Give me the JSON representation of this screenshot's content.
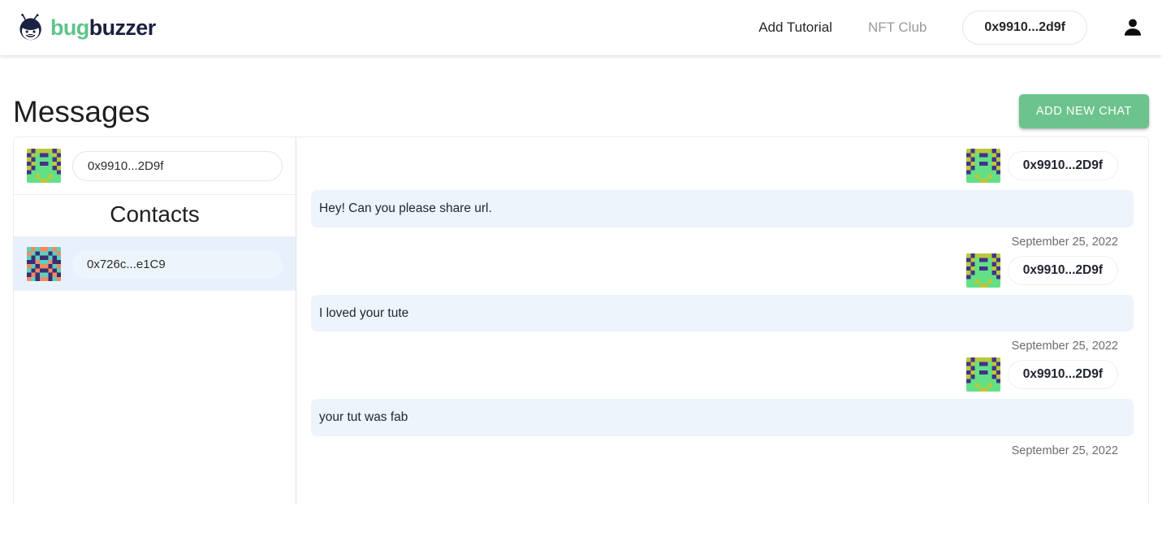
{
  "header": {
    "brand": {
      "part1": "bug",
      "part2": "buzzer",
      "logo_icon": "bug-logo-icon"
    },
    "nav": [
      {
        "label": "Add Tutorial",
        "name": "nav-add-tutorial",
        "muted": false
      },
      {
        "label": "NFT Club",
        "name": "nav-nft-club",
        "muted": true
      }
    ],
    "wallet_address": "0x9910...2d9f",
    "account_icon": "person-icon"
  },
  "page": {
    "title": "Messages",
    "add_chat_label": "ADD NEW CHAT"
  },
  "sidebar": {
    "my_address": "0x9910...2D9f",
    "contacts_heading": "Contacts",
    "contacts": [
      {
        "address": "0x726c...e1C9",
        "selected": true
      }
    ]
  },
  "chat": {
    "messages": [
      {
        "author": "0x9910...2D9f",
        "text": "Hey! Can you please share url.",
        "date": "September 25, 2022"
      },
      {
        "author": "0x9910...2D9f",
        "text": "I loved your tute",
        "date": "September 25, 2022"
      },
      {
        "author": "0x9910...2D9f",
        "text": "your tut was fab",
        "date": "September 25, 2022"
      }
    ]
  },
  "colors": {
    "brand_green": "#5dc48b",
    "brand_navy": "#1b2140",
    "button_green": "#6cc38d",
    "bubble_blue": "#eef4fb",
    "selected_row": "#e8f1fb"
  }
}
